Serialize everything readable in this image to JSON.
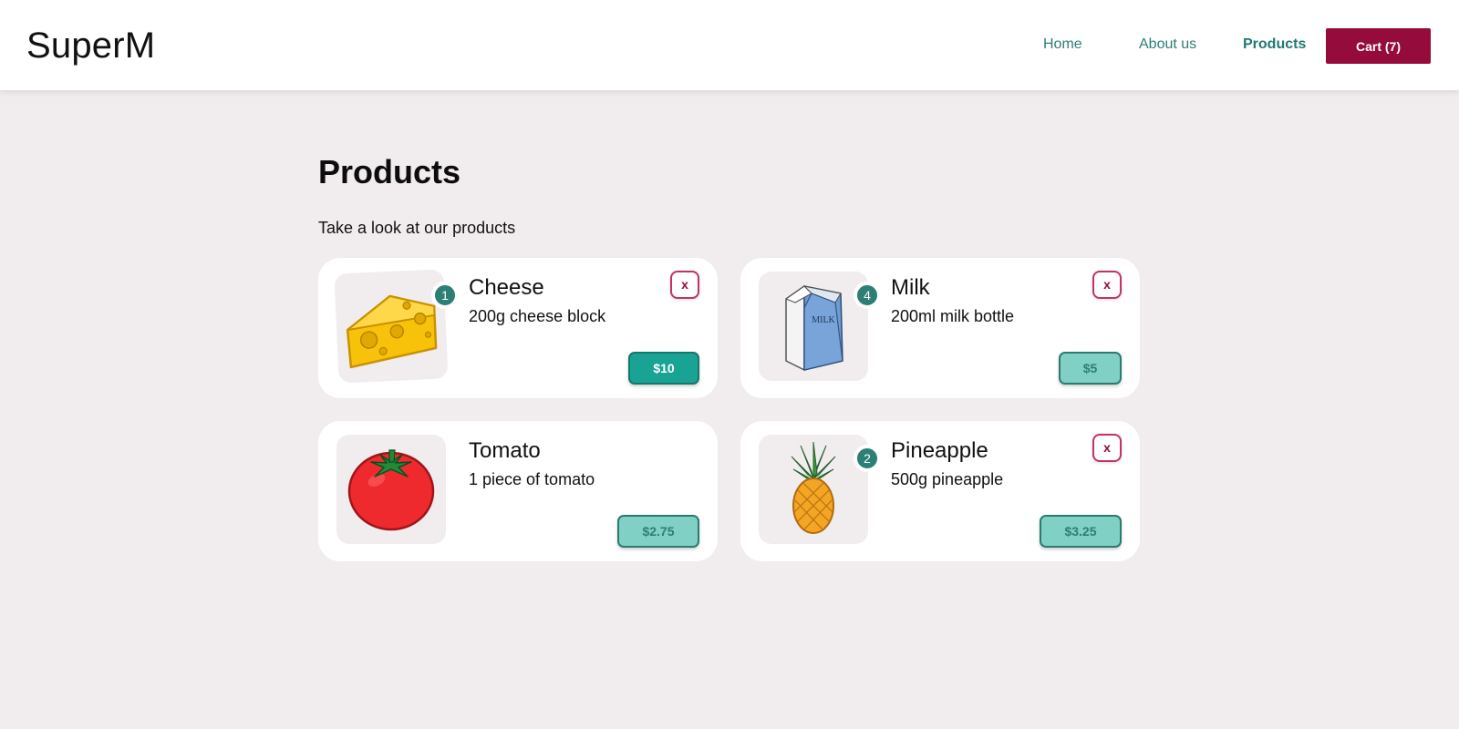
{
  "brand": "SuperM",
  "nav": {
    "home": "Home",
    "about": "About us",
    "products": "Products",
    "cart": "Cart (7)"
  },
  "page": {
    "title": "Products",
    "subtitle": "Take a look at our products"
  },
  "products": [
    {
      "name": "Cheese",
      "description": "200g cheese block",
      "quantity": "1",
      "remove": "x",
      "price": "$10",
      "image": "cheese-image"
    },
    {
      "name": "Milk",
      "description": "200ml milk bottle",
      "quantity": "4",
      "remove": "x",
      "price": "$5",
      "image": "milk-image",
      "image_label": "MILK"
    },
    {
      "name": "Tomato",
      "description": "1 piece of tomato",
      "price": "$2.75",
      "image": "tomato-image"
    },
    {
      "name": "Pineapple",
      "description": "500g pineapple",
      "quantity": "2",
      "remove": "x",
      "price": "$3.25",
      "image": "pineapple-image"
    }
  ],
  "colors": {
    "accent": "#950c3c",
    "teal": "#2b7f75",
    "background": "#f1ecee"
  }
}
